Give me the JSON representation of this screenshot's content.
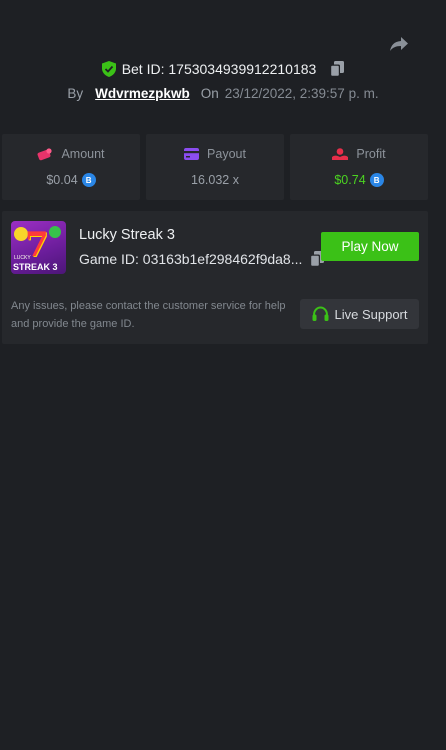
{
  "header": {
    "bet_id_label": "Bet ID: 1753034939912210183",
    "by_label": "By",
    "username": "Wdvrmezpkwb",
    "on_label": "On",
    "date": "23/12/2022, 2:39:57 p. m."
  },
  "stats": {
    "amount": {
      "label": "Amount",
      "value": "$0.04",
      "icon": "coins-icon"
    },
    "payout": {
      "label": "Payout",
      "value": "16.032 x",
      "icon": "wallet-icon"
    },
    "profit": {
      "label": "Profit",
      "value": "$0.74",
      "icon": "profit-icon"
    }
  },
  "game": {
    "title": "Lucky Streak 3",
    "game_id": "Game ID: 03163b1ef298462f9da8...",
    "thumb_small": "LUCKY",
    "thumb_text": "STREAK 3",
    "thumb_seven": "7",
    "play_label": "Play Now",
    "help_text": "Any issues, please contact the customer service for help and provide the game ID.",
    "support_label": "Live Support"
  },
  "coin_symbol": "B",
  "colors": {
    "background": "#1e2024",
    "card": "#26282c",
    "accent_green": "#3bc117",
    "profit_green": "#4bd321",
    "coin_blue": "#2a86e6"
  }
}
